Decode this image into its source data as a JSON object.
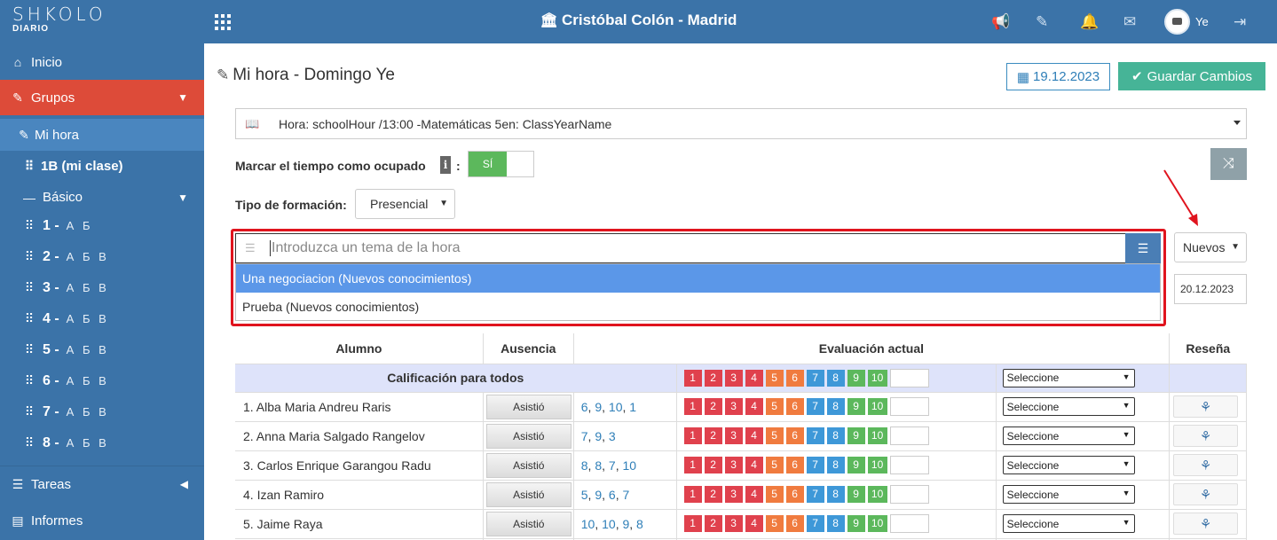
{
  "topbar": {
    "logo_main": "SHKOLO",
    "logo_sub": "DIARIO",
    "school_name": "Cristóbal Colón - Madrid",
    "user_name": "Ye"
  },
  "sidebar": {
    "home": "Inicio",
    "groups": "Grupos",
    "my_hour": "Mi hora",
    "my_class": "1B (mi clase)",
    "basic": "Básico",
    "grades": [
      {
        "num": "1 -",
        "sections": "А Б"
      },
      {
        "num": "2 -",
        "sections": "А Б В"
      },
      {
        "num": "3 -",
        "sections": "А Б В"
      },
      {
        "num": "4 -",
        "sections": "А Б В"
      },
      {
        "num": "5 -",
        "sections": "А Б В"
      },
      {
        "num": "6 -",
        "sections": "А Б В"
      },
      {
        "num": "7 -",
        "sections": "А Б В"
      },
      {
        "num": "8 -",
        "sections": "А Б В"
      }
    ],
    "tasks": "Tareas",
    "reports": "Informes"
  },
  "main": {
    "title": "Mi hora - Domingo Ye",
    "date": "19.12.2023",
    "save_label": "Guardar Cambios",
    "hour_select": "Hora: schoolHour /13:00 -Matemáticas 5en: ClassYearName",
    "busy_label": "Marcar el tiempo como ocupado",
    "toggle_label": "SÍ",
    "training_label": "Tipo de formación:",
    "training_value": "Presencial",
    "topic_placeholder": "Introduzca un tema de la hora",
    "dropdown": [
      "Una negociacion (Nuevos conocimientos)",
      "Prueba (Nuevos conocimientos)"
    ],
    "new_select": "Nuevos",
    "topic_date": "20.12.2023"
  },
  "table": {
    "headers": {
      "student": "Alumno",
      "absence": "Ausencia",
      "evaluation": "Evaluación actual",
      "review": "Reseña"
    },
    "all_label": "Calificación para todos",
    "select_placeholder": "Seleccione",
    "absence_label": "Asistió",
    "scale": [
      "1",
      "2",
      "3",
      "4",
      "5",
      "6",
      "7",
      "8",
      "9",
      "10"
    ],
    "scale_colors": [
      "#e0414d",
      "#e0414d",
      "#e0414d",
      "#e0414d",
      "#f07b3f",
      "#f07b3f",
      "#3e98d8",
      "#3e98d8",
      "#5cb85c",
      "#5cb85c"
    ],
    "rows": [
      {
        "name": "1. Alba Maria Andreu Raris",
        "grades": [
          "6",
          "9",
          "10",
          "1"
        ]
      },
      {
        "name": "2. Anna Maria Salgado Rangelov",
        "grades": [
          "7",
          "9",
          "3"
        ]
      },
      {
        "name": "3. Carlos Enrique Garangou Radu",
        "grades": [
          "8",
          "8",
          "7",
          "10"
        ]
      },
      {
        "name": "4. Izan Ramiro",
        "grades": [
          "5",
          "9",
          "6",
          "7"
        ]
      },
      {
        "name": "5. Jaime Raya",
        "grades": [
          "10",
          "10",
          "9",
          "8"
        ]
      }
    ]
  }
}
